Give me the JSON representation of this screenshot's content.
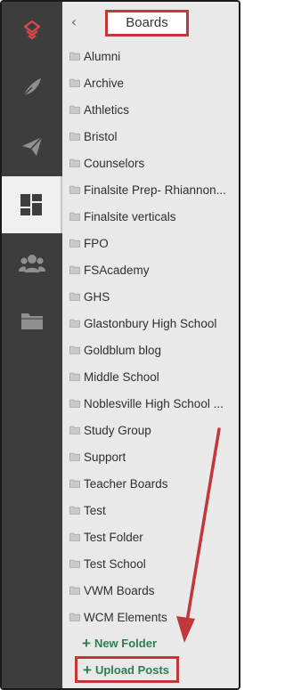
{
  "rail": {
    "items": [
      {
        "name": "brand-logo-icon",
        "active": false
      },
      {
        "name": "feather-icon",
        "active": false
      },
      {
        "name": "paper-plane-icon",
        "active": false
      },
      {
        "name": "dashboard-icon",
        "active": true
      },
      {
        "name": "users-icon",
        "active": false
      },
      {
        "name": "folder-icon",
        "active": false
      }
    ]
  },
  "panel": {
    "back_icon": "chevron-left-icon",
    "title": "Boards",
    "boards": [
      "Alumni",
      "Archive",
      "Athletics",
      "Bristol",
      "Counselors",
      "Finalsite Prep- Rhiannon...",
      "Finalsite verticals",
      "FPO",
      "FSAcademy",
      "GHS",
      "Glastonbury High School",
      "Goldblum blog",
      "Middle School",
      "Noblesville High School ...",
      "Study Group",
      "Support",
      "Teacher Boards",
      "Test",
      "Test Folder",
      "Test School",
      "VWM Boards",
      "WCM Elements"
    ],
    "new_folder_label": "New Folder",
    "upload_posts_label": "Upload Posts"
  },
  "colors": {
    "rail_bg": "#3d3d3d",
    "panel_bg": "#e9e9e9",
    "highlight_red": "#c0383a",
    "action_green": "#2e7d4f",
    "brand_red": "#e0484b"
  }
}
